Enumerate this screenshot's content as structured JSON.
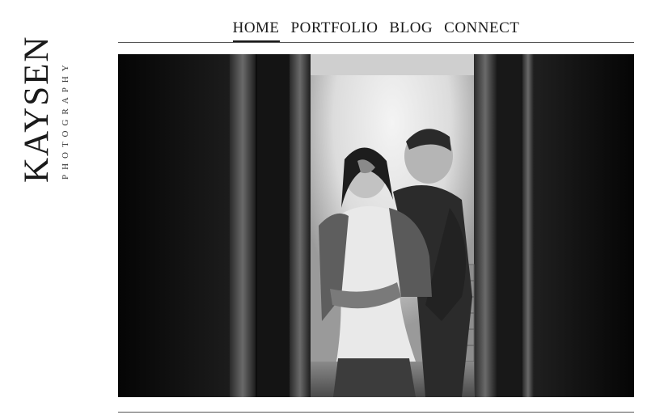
{
  "brand": {
    "name": "KAYSEN",
    "tagline": "PHOTOGRAPHY"
  },
  "nav": {
    "items": [
      {
        "label": "HOME",
        "active": true
      },
      {
        "label": "PORTFOLIO",
        "active": false
      },
      {
        "label": "BLOG",
        "active": false
      },
      {
        "label": "CONNECT",
        "active": false
      }
    ]
  },
  "hero": {
    "alt_icon": "photo-image",
    "tone": "black-and-white"
  },
  "colors": {
    "text": "#1a1a1a",
    "rule": "#555555",
    "background": "#ffffff"
  }
}
